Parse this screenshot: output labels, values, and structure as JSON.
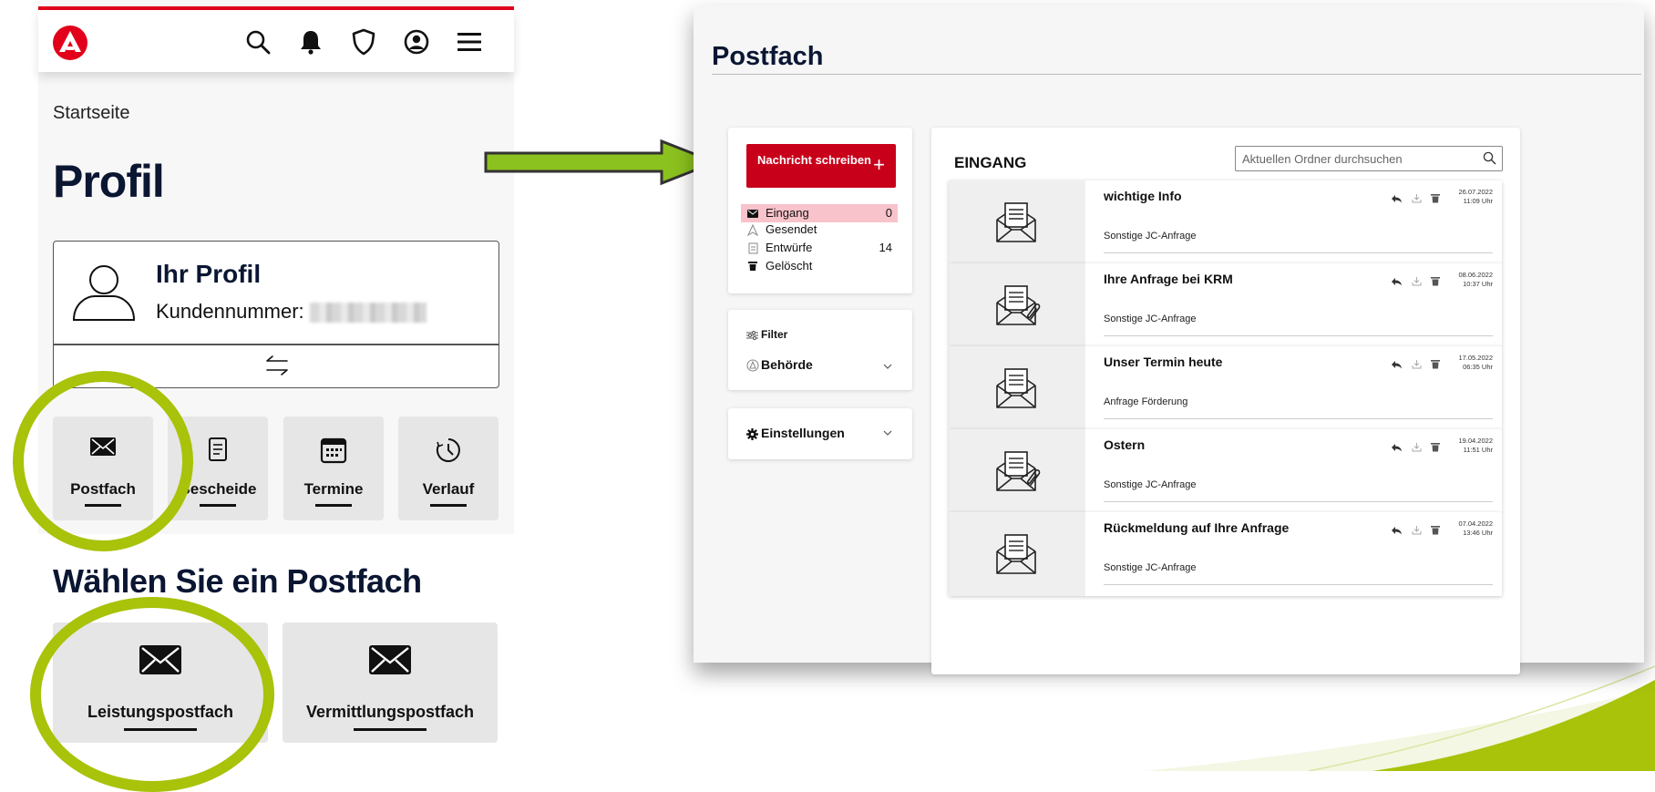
{
  "mobile": {
    "breadcrumb": "Startseite",
    "page_title": "Profil",
    "profile": {
      "title": "Ihr Profil",
      "customer_number_label": "Kundennummer:"
    },
    "tiles": [
      {
        "label": "Postfach",
        "icon": "envelope-icon"
      },
      {
        "label": "Bescheide",
        "icon": "document-icon"
      },
      {
        "label": "Termine",
        "icon": "calendar-icon"
      },
      {
        "label": "Verlauf",
        "icon": "clock-icon"
      }
    ],
    "section_title": "Wählen Sie ein Postfach",
    "mailboxes": [
      {
        "label": "Leistungspostfach",
        "icon": "envelope-icon"
      },
      {
        "label": "Vermittlungspostfach",
        "icon": "envelope-icon"
      }
    ],
    "header_icons": [
      "logo-icon",
      "search-icon",
      "bell-icon",
      "shield-icon",
      "user-circle-icon",
      "menu-icon"
    ]
  },
  "desktop": {
    "title": "Postfach",
    "compose_label": "Nachricht schreiben",
    "compose_plus": "+",
    "folders": [
      {
        "label": "Eingang",
        "count": "0",
        "icon": "envelope-icon"
      },
      {
        "label": "Gesendet",
        "count": "",
        "icon": "send-icon"
      },
      {
        "label": "Entwürfe",
        "count": "14",
        "icon": "draft-icon"
      },
      {
        "label": "Gelöscht",
        "count": "",
        "icon": "trash-icon"
      }
    ],
    "filter_label": "Filter",
    "authority_label": "Behörde",
    "settings_label": "Einstellungen",
    "inbox": {
      "title": "EINGANG",
      "search_placeholder": "Aktuellen Ordner durchsuchen",
      "messages": [
        {
          "subject": "wichtige Info",
          "category": "Sonstige JC-Anfrage",
          "date": "26.07.2022",
          "time": "11:09 Uhr",
          "attachment": false
        },
        {
          "subject": "Ihre Anfrage bei KRM",
          "category": "Sonstige JC-Anfrage",
          "date": "08.06.2022",
          "time": "10:37 Uhr",
          "attachment": true
        },
        {
          "subject": "Unser Termin heute",
          "category": "Anfrage Förderung",
          "date": "17.05.2022",
          "time": "06:35 Uhr",
          "attachment": false
        },
        {
          "subject": "Ostern",
          "category": "Sonstige JC-Anfrage",
          "date": "19.04.2022",
          "time": "11:51 Uhr",
          "attachment": true
        },
        {
          "subject": "Rückmeldung auf Ihre Anfrage",
          "category": "Sonstige JC-Anfrage",
          "date": "07.04.2022",
          "time": "13:46 Uhr",
          "attachment": false
        }
      ]
    }
  },
  "colors": {
    "brand_red": "#e2001a",
    "compose_red": "#c8001a",
    "highlight_green": "#a9c20a",
    "arrow_green": "#8cc21f",
    "title_navy": "#0a1632",
    "active_folder": "#f8c3cb"
  }
}
